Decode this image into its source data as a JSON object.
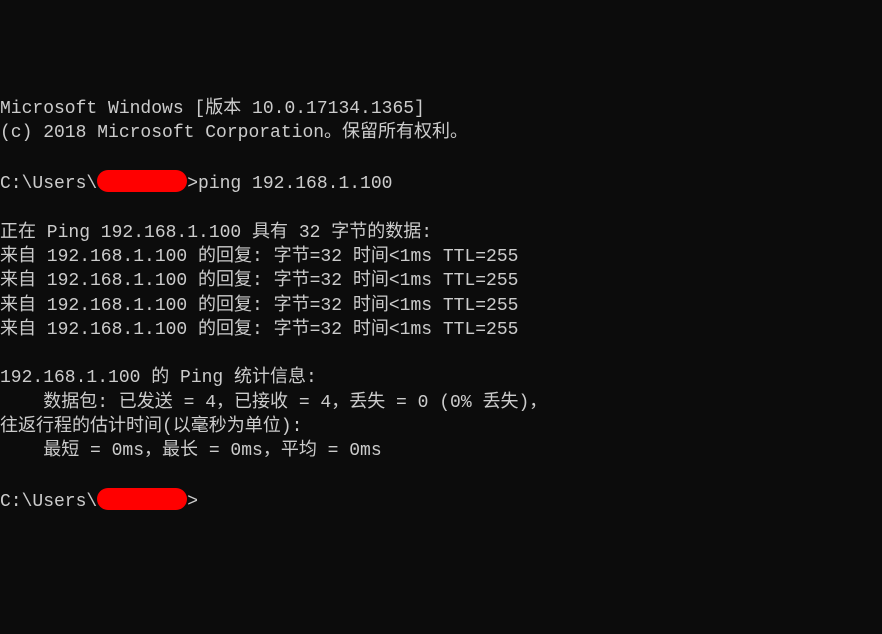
{
  "header": {
    "line1": "Microsoft Windows [版本 10.0.17134.1365]",
    "line2": "(c) 2018 Microsoft Corporation。保留所有权利。"
  },
  "prompt1": {
    "prefix": "C:\\Users\\",
    "suffix": ">",
    "command": "ping 192.168.1.100"
  },
  "ping": {
    "start": "正在 Ping 192.168.1.100 具有 32 字节的数据:",
    "replies": [
      "来自 192.168.1.100 的回复: 字节=32 时间<1ms TTL=255",
      "来自 192.168.1.100 的回复: 字节=32 时间<1ms TTL=255",
      "来自 192.168.1.100 的回复: 字节=32 时间<1ms TTL=255",
      "来自 192.168.1.100 的回复: 字节=32 时间<1ms TTL=255"
    ],
    "stats_header": "192.168.1.100 的 Ping 统计信息:",
    "stats_packets": "    数据包: 已发送 = 4，已接收 = 4，丢失 = 0 (0% 丢失)，",
    "rt_header": "往返行程的估计时间(以毫秒为单位):",
    "rt_values": "    最短 = 0ms，最长 = 0ms，平均 = 0ms"
  },
  "prompt2": {
    "prefix": "C:\\Users\\",
    "suffix": ">"
  }
}
